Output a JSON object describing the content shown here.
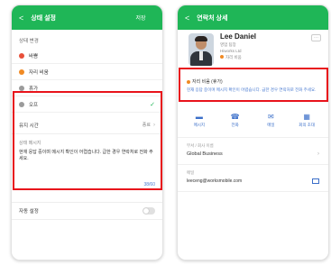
{
  "left": {
    "header": {
      "back": "<",
      "title": "상태 설정",
      "action": "저장"
    },
    "status_section_label": "상태 변경",
    "statuses": [
      {
        "label": "바쁨",
        "color": "#e8503a"
      },
      {
        "label": "자리 비움",
        "color": "#f08a24"
      },
      {
        "label": "휴가",
        "color": "#9b9b9b"
      },
      {
        "label": "오프",
        "color": "#9b9b9b"
      }
    ],
    "check_icon": "✓",
    "duration": {
      "label": "유지 시간",
      "value": "종료"
    },
    "message": {
      "label": "상태 메시지",
      "text": "현재 응답 중이며 메시지 확인이 어렵습니다. 급한 경우 연락처로 전화 주세요.",
      "count": "38/60"
    },
    "auto_setting": {
      "label": "자동 설정"
    }
  },
  "right": {
    "header": {
      "back": "<",
      "title": "연락처 상세"
    },
    "profile": {
      "name": "Lee Daniel",
      "position": "영업 팀장",
      "company": "Hiworks Ltd",
      "status": "자리 비움",
      "more": "⋯"
    },
    "status_card": {
      "title": "자리 비움 (휴가)",
      "message": "현재 응답 중이며 메시지 확인이 어렵습니다. 급한 경우 연락처로 전화 주세요."
    },
    "actions": [
      {
        "label": "메시지",
        "icon": "chat-icon",
        "glyph": "▬"
      },
      {
        "label": "전화",
        "icon": "phone-icon",
        "glyph": "☎"
      },
      {
        "label": "메일",
        "icon": "mail-icon",
        "glyph": "✉"
      },
      {
        "label": "회의 초대",
        "icon": "calendar-icon",
        "glyph": "▦"
      }
    ],
    "department": {
      "label": "부서 / 회사 이름",
      "value": "Global Business"
    },
    "email": {
      "label": "메일",
      "value": "leeceng@worksmobile.com"
    }
  },
  "colors": {
    "brand_green": "#1fb657",
    "highlight_red": "#e8131b",
    "link_blue": "#4a7bd1"
  }
}
